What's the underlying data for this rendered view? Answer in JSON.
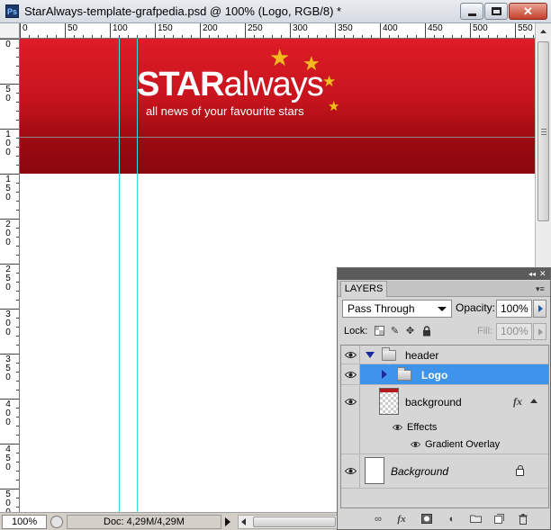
{
  "window": {
    "app_icon": "Ps",
    "title": "StarAlways-template-grafpedia.psd @ 100% (Logo, RGB/8) *",
    "close_glyph": "✕"
  },
  "rulers": {
    "top_labels": [
      "0",
      "50",
      "100",
      "150",
      "200",
      "250",
      "300",
      "350",
      "400",
      "450",
      "500",
      "550"
    ],
    "left_labels": [
      [
        "0"
      ],
      [
        "5",
        "0"
      ],
      [
        "1",
        "0",
        "0"
      ],
      [
        "1",
        "5",
        "0"
      ],
      [
        "2",
        "0",
        "0"
      ],
      [
        "2",
        "5",
        "0"
      ],
      [
        "3",
        "0",
        "0"
      ],
      [
        "3",
        "5",
        "0"
      ],
      [
        "4",
        "0",
        "0"
      ],
      [
        "4",
        "5",
        "0"
      ],
      [
        "5",
        "0",
        "0"
      ]
    ]
  },
  "canvas": {
    "logo_bold": "STAR",
    "logo_light": "always",
    "tagline": "all news of your favourite stars",
    "header_color": "#c7141d",
    "star_color": "#f5b920",
    "guide_color": "#33dede"
  },
  "status": {
    "zoom": "100%",
    "doc_info": "Doc: 4,29M/4,29M"
  },
  "layers_panel": {
    "tab_label": "LAYERS",
    "blend_mode": "Pass Through",
    "opacity_label": "Opacity:",
    "opacity_value": "100%",
    "lock_label": "Lock:",
    "fill_label": "Fill:",
    "fill_value": "100%",
    "layers": [
      {
        "name": "header",
        "type": "group",
        "expanded": true,
        "visible": true
      },
      {
        "name": "Logo",
        "type": "group",
        "expanded": false,
        "visible": true,
        "selected": true
      },
      {
        "name": "background",
        "type": "layer",
        "has_fx": true,
        "visible": true
      },
      {
        "name": "Effects",
        "type": "effects",
        "visible": true
      },
      {
        "name": "Gradient Overlay",
        "type": "effect",
        "visible": true
      },
      {
        "name": "Background",
        "type": "layer",
        "locked": true,
        "visible": true
      }
    ],
    "selected_color": "#3d94ea",
    "fx_glyph": "fx",
    "bottom_icons": [
      "link-icon",
      "fx-icon",
      "mask-icon",
      "adjustment-icon",
      "group-icon",
      "new-layer-icon",
      "trash-icon"
    ]
  }
}
